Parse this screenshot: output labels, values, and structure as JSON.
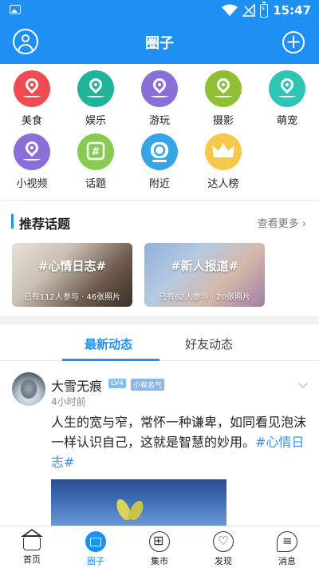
{
  "status_bar": {
    "time": "15:47"
  },
  "header": {
    "title": "圈子"
  },
  "categories": [
    {
      "label": "美食",
      "color": "#f14b52",
      "icon": "map-pin-icon"
    },
    {
      "label": "娱乐",
      "color": "#1fb39a",
      "icon": "map-pin-icon"
    },
    {
      "label": "游玩",
      "color": "#8a6fd8",
      "icon": "map-pin-icon"
    },
    {
      "label": "摄影",
      "color": "#8fbf35",
      "icon": "map-pin-icon"
    },
    {
      "label": "萌宠",
      "color": "#2ec4b6",
      "icon": "map-pin-icon"
    },
    {
      "label": "小视频",
      "color": "#8a6fd8",
      "icon": "map-pin-icon"
    },
    {
      "label": "话题",
      "color": "#86cc52",
      "icon": "hashtag-icon"
    },
    {
      "label": "附近",
      "color": "#36a5e8",
      "icon": "target-icon"
    },
    {
      "label": "达人榜",
      "color": "#f6c84a",
      "icon": "crown-icon"
    }
  ],
  "topics": {
    "title": "推荐话题",
    "more": "查看更多",
    "cards": [
      {
        "tag": "#心情日志#",
        "meta": "已有112人参与 · 46张照片"
      },
      {
        "tag": "#新人报道#",
        "meta": "已有62人参与 · 20张照片"
      }
    ]
  },
  "tabs": {
    "active": "最新动态",
    "inactive": "好友动态"
  },
  "post": {
    "username": "大雪无痕",
    "level": "LV4",
    "badge": "小有名气",
    "time": "4小时前",
    "text": "人生的宽与窄，常怀一种谦卑，如同看见泡沫一样认识自己，这就是智慧的妙用。",
    "hashtag": "#心情日志#"
  },
  "bottom_nav": [
    {
      "label": "首页"
    },
    {
      "label": "圈子"
    },
    {
      "label": "集市"
    },
    {
      "label": "发现"
    },
    {
      "label": "消息"
    }
  ],
  "colors": {
    "primary": "#1e8ff3",
    "hashtag": "#3d8fe6"
  }
}
